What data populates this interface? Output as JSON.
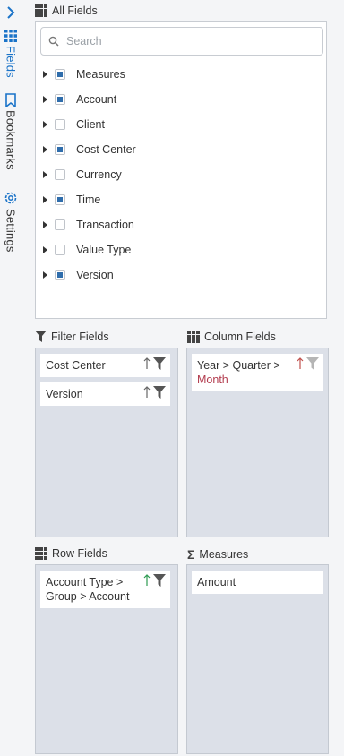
{
  "rail": {
    "tabs": [
      {
        "label": "Fields",
        "icon": "grid-icon",
        "active": true
      },
      {
        "label": "Bookmarks",
        "icon": "bookmark-icon",
        "active": false
      },
      {
        "label": "Settings",
        "icon": "gear-icon",
        "active": false
      }
    ]
  },
  "all_fields": {
    "title": "All Fields",
    "search_placeholder": "Search",
    "items": [
      {
        "label": "Measures",
        "checked": true
      },
      {
        "label": "Account",
        "checked": true
      },
      {
        "label": "Client",
        "checked": false
      },
      {
        "label": "Cost Center",
        "checked": true
      },
      {
        "label": "Currency",
        "checked": false
      },
      {
        "label": "Time",
        "checked": true
      },
      {
        "label": "Transaction",
        "checked": false
      },
      {
        "label": "Value Type",
        "checked": false
      },
      {
        "label": "Version",
        "checked": true
      }
    ]
  },
  "filter_fields": {
    "title": "Filter Fields",
    "chips": [
      {
        "label": "Cost Center"
      },
      {
        "label": "Version"
      }
    ]
  },
  "column_fields": {
    "title": "Column Fields",
    "chips": [
      {
        "label_a": "Year > Quarter >",
        "label_b": "Month"
      }
    ]
  },
  "row_fields": {
    "title": "Row Fields",
    "chips": [
      {
        "label_a": "Account Type >",
        "label_b": "Group > Account"
      }
    ]
  },
  "measures": {
    "title": "Measures",
    "chips": [
      {
        "label": "Amount"
      }
    ]
  },
  "colors": {
    "accent": "#1a73c8",
    "checkbox": "#2f6dac",
    "drop_zone": "#dce0e8",
    "sort_green": "#2e9b52",
    "sort_red": "#c0504d",
    "filter_gray": "#555555"
  }
}
